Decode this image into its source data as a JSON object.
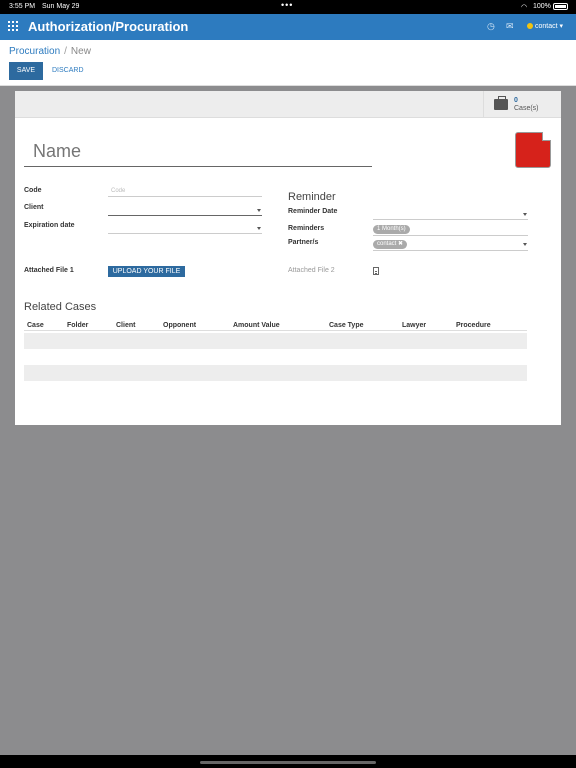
{
  "statusbar": {
    "time": "3:55 PM",
    "date": "Sun May 29",
    "battery": "100%"
  },
  "navbar": {
    "title": "Authorization/Procuration",
    "user": "contact"
  },
  "breadcrumb": {
    "parent": "Procuration",
    "separator": "/",
    "current": "New"
  },
  "actions": {
    "save": "SAVE",
    "discard": "DISCARD"
  },
  "stat_button": {
    "count": "0",
    "label": "Case(s)"
  },
  "form": {
    "name_placeholder": "Name",
    "code_label": "Code",
    "code_placeholder": "Code",
    "client_label": "Client",
    "expiration_label": "Expiration date",
    "attached1_label": "Attached File 1",
    "upload_label": "UPLOAD YOUR FILE"
  },
  "reminder": {
    "title": "Reminder",
    "date_label": "Reminder Date",
    "reminders_label": "Reminders",
    "reminders_tag": "1 Month(s)",
    "partners_label": "Partner/s",
    "partners_tag": "contact ✖",
    "attached2_label": "Attached File 2"
  },
  "related": {
    "title": "Related Cases",
    "columns": [
      "Case",
      "Folder",
      "Client",
      "Opponent",
      "Amount Value",
      "Case Type",
      "Lawyer",
      "Procedure"
    ]
  },
  "icons": {
    "apps": "grid-icon",
    "chat": "chat-icon",
    "clock": "clock-icon",
    "briefcase": "briefcase-icon",
    "pdf": "pdf-icon",
    "file": "file-icon"
  }
}
